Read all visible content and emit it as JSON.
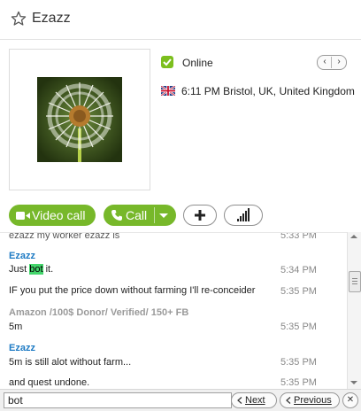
{
  "header": {
    "title": "Ezazz"
  },
  "profile": {
    "status": "Online",
    "location": "6:11 PM Bristol, UK, United Kingdom",
    "nav_prev": "‹",
    "nav_next": "›",
    "avatar_colors": {
      "bg": "#2e3f14",
      "center": "#b57b2e"
    }
  },
  "actions": {
    "video_call": "Video call",
    "call": "Call",
    "add": "+",
    "brand_green": "#77b82a"
  },
  "chat": {
    "partial_top": "ezazz my worker ezazz is",
    "partial_top_time": "5:33 PM",
    "messages": [
      {
        "sender": "Ezazz",
        "sender_style": "blue",
        "lines": [
          {
            "pre": "Just ",
            "hl": "bot",
            "post": " it.",
            "time": "5:34 PM"
          },
          {
            "pre": "IF you put the price down without farming I'll re-conceider",
            "hl": "",
            "post": "",
            "time": "5:35 PM"
          }
        ]
      },
      {
        "sender": "Amazon /100$ Donor/ Verified/ 150+ FB",
        "sender_style": "gray",
        "lines": [
          {
            "pre": "5m",
            "hl": "",
            "post": "",
            "time": "5:35 PM"
          }
        ]
      },
      {
        "sender": "Ezazz",
        "sender_style": "blue",
        "lines": [
          {
            "pre": "5m is still alot without farm...",
            "hl": "",
            "post": "",
            "time": "5:35 PM"
          },
          {
            "pre": "and quest undone.",
            "hl": "",
            "post": "",
            "time": "5:35 PM"
          }
        ]
      }
    ]
  },
  "findbar": {
    "query": "bot",
    "next": "Next",
    "previous": "Previous",
    "close": "✕"
  }
}
